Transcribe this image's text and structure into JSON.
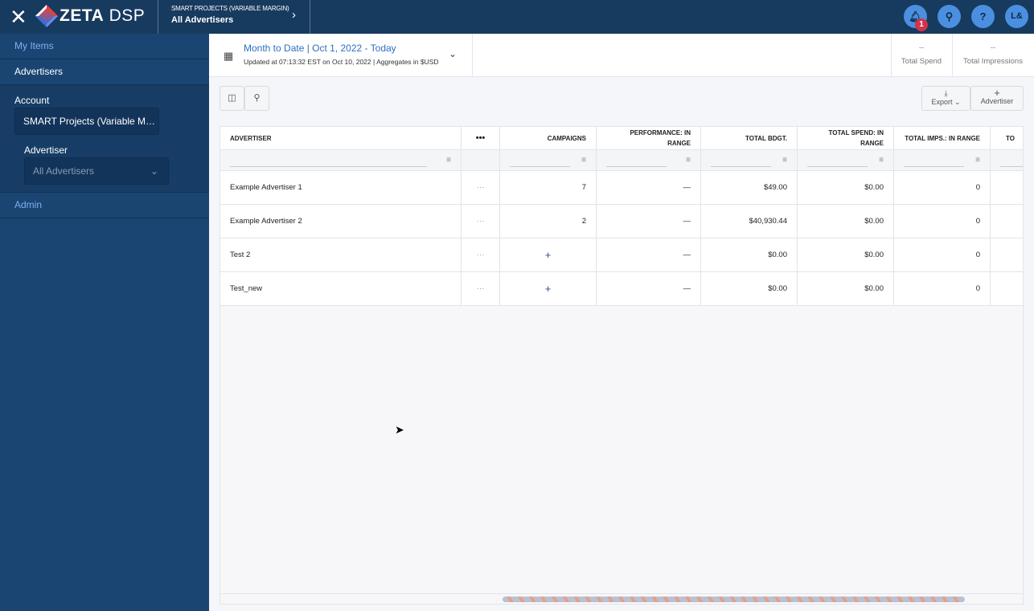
{
  "topbar": {
    "brand": "ZETA",
    "product": "DSP",
    "breadcrumb_sub": "SMART PROJECTS (VARIABLE MARGIN)",
    "breadcrumb_main": "All Advertisers",
    "notification_count": "1",
    "user_initials": "L&",
    "help": "?"
  },
  "sidebar": {
    "my_items": "My Items",
    "advertisers": "Advertisers",
    "account_label": "Account",
    "account_value": "SMART Projects (Variable M…",
    "advertiser_label": "Advertiser",
    "advertiser_value": "All Advertisers",
    "admin": "Admin"
  },
  "header": {
    "date_range": "Month to Date | Oct 1, 2022 - Today",
    "updated": "Updated at 07:13:32 EST on Oct 10, 2022 | Aggregates in $USD",
    "stats": [
      {
        "value": "--",
        "label": "Total Spend"
      },
      {
        "value": "--",
        "label": "Total Impressions"
      }
    ]
  },
  "toolbar": {
    "export": "Export",
    "add": "Advertiser"
  },
  "table": {
    "columns": [
      "ADVERTISER",
      "•••",
      "CAMPAIGNS",
      "PERFORMANCE: IN RANGE",
      "TOTAL BDGT.",
      "TOTAL SPEND: IN RANGE",
      "TOTAL IMPS.: IN RANGE",
      "TO"
    ],
    "rows": [
      {
        "name": "Example Advertiser 1",
        "menu": "···",
        "campaigns": "7",
        "performance": "—",
        "budget": "$49.00",
        "spend": "$0.00",
        "imps": "0"
      },
      {
        "name": "Example Advertiser 2",
        "menu": "···",
        "campaigns": "2",
        "performance": "—",
        "budget": "$40,930.44",
        "spend": "$0.00",
        "imps": "0"
      },
      {
        "name": "Test 2",
        "menu": "···",
        "campaigns": "+",
        "performance": "—",
        "budget": "$0.00",
        "spend": "$0.00",
        "imps": "0"
      },
      {
        "name": "Test_new",
        "menu": "···",
        "campaigns": "+",
        "performance": "—",
        "budget": "$0.00",
        "spend": "$0.00",
        "imps": "0"
      }
    ]
  }
}
